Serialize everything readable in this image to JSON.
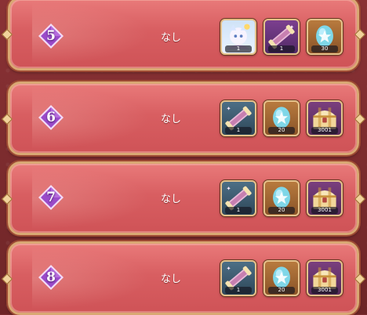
{
  "rows": [
    {
      "rank": "5",
      "condition": "なし",
      "rewards": [
        {
          "icon": "character-portrait-icon",
          "qty": "1"
        },
        {
          "icon": "purple-scroll-icon",
          "qty": "1"
        },
        {
          "icon": "star-egg-icon",
          "qty": "30"
        }
      ]
    },
    {
      "rank": "6",
      "condition": "なし",
      "rewards": [
        {
          "icon": "blue-scroll-icon",
          "qty": "1"
        },
        {
          "icon": "star-egg-icon",
          "qty": "20"
        },
        {
          "icon": "treasure-chest-icon",
          "qty": "3001"
        }
      ]
    },
    {
      "rank": "7",
      "condition": "なし",
      "rewards": [
        {
          "icon": "blue-scroll-icon",
          "qty": "1"
        },
        {
          "icon": "star-egg-icon",
          "qty": "20"
        },
        {
          "icon": "treasure-chest-icon",
          "qty": "3001"
        }
      ]
    },
    {
      "rank": "8",
      "condition": "なし",
      "rewards": [
        {
          "icon": "blue-scroll-icon",
          "qty": "1"
        },
        {
          "icon": "star-egg-icon",
          "qty": "20"
        },
        {
          "icon": "treasure-chest-icon",
          "qty": "3001"
        }
      ]
    }
  ]
}
